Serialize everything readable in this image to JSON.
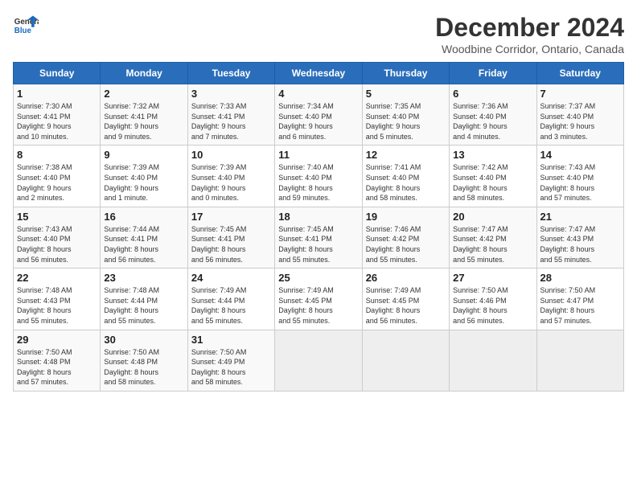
{
  "logo": {
    "line1": "General",
    "line2": "Blue"
  },
  "title": "December 2024",
  "location": "Woodbine Corridor, Ontario, Canada",
  "days_of_week": [
    "Sunday",
    "Monday",
    "Tuesday",
    "Wednesday",
    "Thursday",
    "Friday",
    "Saturday"
  ],
  "weeks": [
    [
      {
        "day": 1,
        "info": "Sunrise: 7:30 AM\nSunset: 4:41 PM\nDaylight: 9 hours\nand 10 minutes."
      },
      {
        "day": 2,
        "info": "Sunrise: 7:32 AM\nSunset: 4:41 PM\nDaylight: 9 hours\nand 9 minutes."
      },
      {
        "day": 3,
        "info": "Sunrise: 7:33 AM\nSunset: 4:41 PM\nDaylight: 9 hours\nand 7 minutes."
      },
      {
        "day": 4,
        "info": "Sunrise: 7:34 AM\nSunset: 4:40 PM\nDaylight: 9 hours\nand 6 minutes."
      },
      {
        "day": 5,
        "info": "Sunrise: 7:35 AM\nSunset: 4:40 PM\nDaylight: 9 hours\nand 5 minutes."
      },
      {
        "day": 6,
        "info": "Sunrise: 7:36 AM\nSunset: 4:40 PM\nDaylight: 9 hours\nand 4 minutes."
      },
      {
        "day": 7,
        "info": "Sunrise: 7:37 AM\nSunset: 4:40 PM\nDaylight: 9 hours\nand 3 minutes."
      }
    ],
    [
      {
        "day": 8,
        "info": "Sunrise: 7:38 AM\nSunset: 4:40 PM\nDaylight: 9 hours\nand 2 minutes."
      },
      {
        "day": 9,
        "info": "Sunrise: 7:39 AM\nSunset: 4:40 PM\nDaylight: 9 hours\nand 1 minute."
      },
      {
        "day": 10,
        "info": "Sunrise: 7:39 AM\nSunset: 4:40 PM\nDaylight: 9 hours\nand 0 minutes."
      },
      {
        "day": 11,
        "info": "Sunrise: 7:40 AM\nSunset: 4:40 PM\nDaylight: 8 hours\nand 59 minutes."
      },
      {
        "day": 12,
        "info": "Sunrise: 7:41 AM\nSunset: 4:40 PM\nDaylight: 8 hours\nand 58 minutes."
      },
      {
        "day": 13,
        "info": "Sunrise: 7:42 AM\nSunset: 4:40 PM\nDaylight: 8 hours\nand 58 minutes."
      },
      {
        "day": 14,
        "info": "Sunrise: 7:43 AM\nSunset: 4:40 PM\nDaylight: 8 hours\nand 57 minutes."
      }
    ],
    [
      {
        "day": 15,
        "info": "Sunrise: 7:43 AM\nSunset: 4:40 PM\nDaylight: 8 hours\nand 56 minutes."
      },
      {
        "day": 16,
        "info": "Sunrise: 7:44 AM\nSunset: 4:41 PM\nDaylight: 8 hours\nand 56 minutes."
      },
      {
        "day": 17,
        "info": "Sunrise: 7:45 AM\nSunset: 4:41 PM\nDaylight: 8 hours\nand 56 minutes."
      },
      {
        "day": 18,
        "info": "Sunrise: 7:45 AM\nSunset: 4:41 PM\nDaylight: 8 hours\nand 55 minutes."
      },
      {
        "day": 19,
        "info": "Sunrise: 7:46 AM\nSunset: 4:42 PM\nDaylight: 8 hours\nand 55 minutes."
      },
      {
        "day": 20,
        "info": "Sunrise: 7:47 AM\nSunset: 4:42 PM\nDaylight: 8 hours\nand 55 minutes."
      },
      {
        "day": 21,
        "info": "Sunrise: 7:47 AM\nSunset: 4:43 PM\nDaylight: 8 hours\nand 55 minutes."
      }
    ],
    [
      {
        "day": 22,
        "info": "Sunrise: 7:48 AM\nSunset: 4:43 PM\nDaylight: 8 hours\nand 55 minutes."
      },
      {
        "day": 23,
        "info": "Sunrise: 7:48 AM\nSunset: 4:44 PM\nDaylight: 8 hours\nand 55 minutes."
      },
      {
        "day": 24,
        "info": "Sunrise: 7:49 AM\nSunset: 4:44 PM\nDaylight: 8 hours\nand 55 minutes."
      },
      {
        "day": 25,
        "info": "Sunrise: 7:49 AM\nSunset: 4:45 PM\nDaylight: 8 hours\nand 55 minutes."
      },
      {
        "day": 26,
        "info": "Sunrise: 7:49 AM\nSunset: 4:45 PM\nDaylight: 8 hours\nand 56 minutes."
      },
      {
        "day": 27,
        "info": "Sunrise: 7:50 AM\nSunset: 4:46 PM\nDaylight: 8 hours\nand 56 minutes."
      },
      {
        "day": 28,
        "info": "Sunrise: 7:50 AM\nSunset: 4:47 PM\nDaylight: 8 hours\nand 57 minutes."
      }
    ],
    [
      {
        "day": 29,
        "info": "Sunrise: 7:50 AM\nSunset: 4:48 PM\nDaylight: 8 hours\nand 57 minutes."
      },
      {
        "day": 30,
        "info": "Sunrise: 7:50 AM\nSunset: 4:48 PM\nDaylight: 8 hours\nand 58 minutes."
      },
      {
        "day": 31,
        "info": "Sunrise: 7:50 AM\nSunset: 4:49 PM\nDaylight: 8 hours\nand 58 minutes."
      },
      null,
      null,
      null,
      null
    ]
  ]
}
